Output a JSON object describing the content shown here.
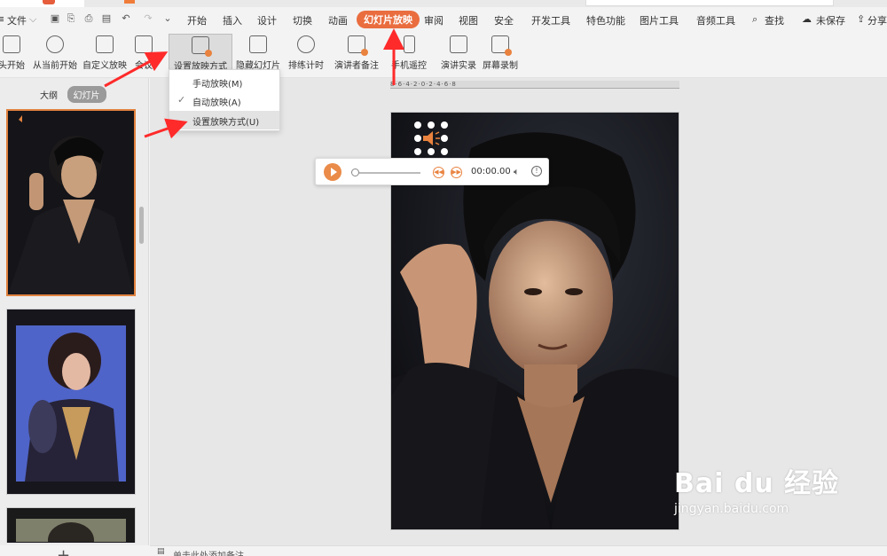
{
  "menubar": {
    "file_label": "文件",
    "items": [
      "开始",
      "插入",
      "设计",
      "切换",
      "动画",
      "幻灯片放映",
      "审阅",
      "视图",
      "安全",
      "开发工具",
      "特色功能",
      "图片工具",
      "音频工具"
    ],
    "active_item": "幻灯片放映",
    "search_label": "查找",
    "save_status": "未保存",
    "share_label": "分享"
  },
  "ribbon": {
    "buttons": [
      "头开始",
      "从当前开始",
      "自定义放映",
      "会议",
      "设置放映方式",
      "隐藏幻灯片",
      "排练计时",
      "演讲者备注",
      "手机遥控",
      "演讲实录",
      "屏幕录制"
    ]
  },
  "dropdown": {
    "items": [
      "手动放映(M)",
      "自动放映(A)",
      "设置放映方式(U)"
    ],
    "checked": "自动放映(A)",
    "highlighted": "设置放映方式(U)"
  },
  "left_panel": {
    "tabs": [
      "大纲",
      "幻灯片"
    ],
    "active_tab": "幻灯片",
    "add_symbol": "+"
  },
  "ruler": {
    "text": "8·6·4·2·0·2·4·6·8"
  },
  "player": {
    "time": "00:00.00"
  },
  "notes": {
    "placeholder": "单击此处添加备注"
  },
  "watermark": {
    "brand": "Bai du 经验",
    "url": "jingyan.baidu.com"
  },
  "colors": {
    "accent": "#ea6d3f",
    "arrow": "#ff2a2a",
    "play": "#ea8b49"
  }
}
